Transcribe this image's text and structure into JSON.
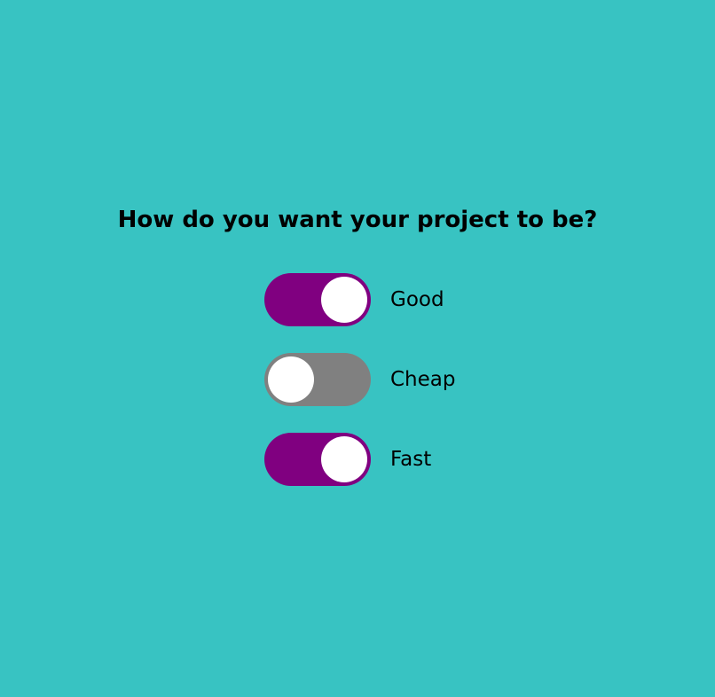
{
  "heading": "How do you want your project to be?",
  "colors": {
    "background": "#38c3c2",
    "toggle_on": "#800080",
    "toggle_off": "#808080",
    "knob": "#ffffff"
  },
  "options": [
    {
      "label": "Good",
      "checked": true
    },
    {
      "label": "Cheap",
      "checked": false
    },
    {
      "label": "Fast",
      "checked": true
    }
  ]
}
